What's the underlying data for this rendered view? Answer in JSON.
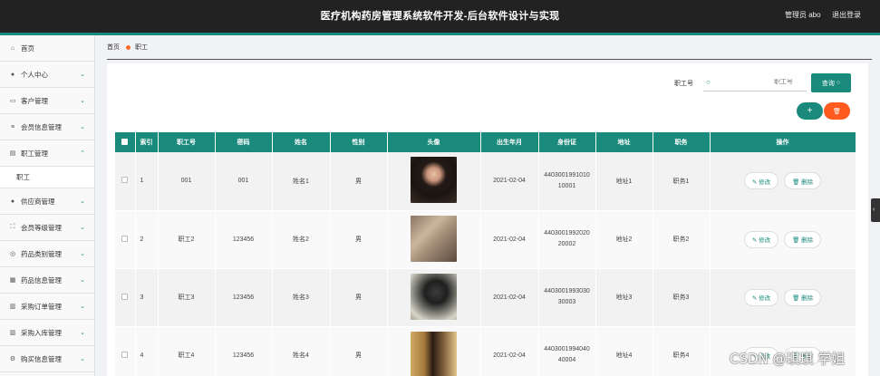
{
  "app": {
    "title": "医疗机构药房管理系统软件开发-后台软件设计与实现",
    "user_label": "管理员 abo",
    "logout_label": "退出登录"
  },
  "sidebar": {
    "items": [
      {
        "label": "首页",
        "icon": "home-icon"
      },
      {
        "label": "个人中心",
        "icon": "user-icon"
      },
      {
        "label": "客户管理",
        "icon": "card-icon"
      },
      {
        "label": "会员信息管理",
        "icon": "list-icon"
      },
      {
        "label": "职工管理",
        "icon": "idcard-icon",
        "expanded": true,
        "sub": "职工"
      },
      {
        "label": "供应商管理",
        "icon": "user-icon"
      },
      {
        "label": "会员等级管理",
        "icon": "expand-icon"
      },
      {
        "label": "药品类别管理",
        "icon": "circle-icon"
      },
      {
        "label": "药品信息管理",
        "icon": "box-icon"
      },
      {
        "label": "采购订单管理",
        "icon": "doc-icon"
      },
      {
        "label": "采购入库管理",
        "icon": "doc-icon"
      },
      {
        "label": "购买信息管理",
        "icon": "gear-icon"
      }
    ]
  },
  "breadcrumb": {
    "home": "首页",
    "current": "职工"
  },
  "search": {
    "label": "职工号",
    "placeholder": "职工号",
    "query_label": "查询"
  },
  "toolbar": {
    "add_label": "+",
    "delete_label": "🗑"
  },
  "table": {
    "headers": [
      "",
      "索引",
      "职工号",
      "密码",
      "姓名",
      "性别",
      "头像",
      "出生年月",
      "身份证",
      "地址",
      "职务",
      "操作"
    ],
    "rows": [
      {
        "index": "1",
        "staff_no": "001",
        "password": "001",
        "name": "姓名1",
        "gender": "男",
        "birth": "2021-02-04",
        "id_card": "440300199101010001",
        "address": "地址1",
        "position": "职务1"
      },
      {
        "index": "2",
        "staff_no": "职工2",
        "password": "123456",
        "name": "姓名2",
        "gender": "男",
        "birth": "2021-02-04",
        "id_card": "440300199202020002",
        "address": "地址2",
        "position": "职务2"
      },
      {
        "index": "3",
        "staff_no": "职工3",
        "password": "123456",
        "name": "姓名3",
        "gender": "男",
        "birth": "2021-02-04",
        "id_card": "440300199303030003",
        "address": "地址3",
        "position": "职务3"
      },
      {
        "index": "4",
        "staff_no": "职工4",
        "password": "123456",
        "name": "姓名4",
        "gender": "男",
        "birth": "2021-02-04",
        "id_card": "440300199404040004",
        "address": "地址4",
        "position": "职务4"
      }
    ],
    "edit_label": "✎ 修改",
    "delete_label": "🗑 删除"
  },
  "watermark": "CSDN @琪琪 学姐",
  "colors": {
    "accent": "#1a8a7c",
    "danger": "#ff5a1f",
    "topbar": "#222222"
  }
}
